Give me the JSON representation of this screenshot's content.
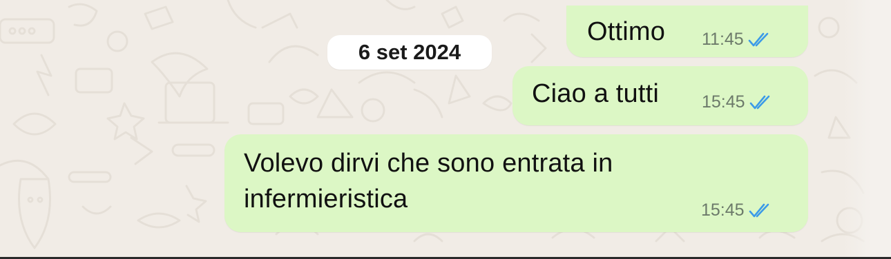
{
  "date_separator": "6 set 2024",
  "messages": [
    {
      "text": "Ottimo",
      "time": "11:45",
      "status": "read-double-check-icon"
    },
    {
      "text": "Ciao a tutti",
      "time": "15:45",
      "status": "read-double-check-icon"
    },
    {
      "text": "Volevo dirvi che sono entrata in\ninfermieristica",
      "time": "15:45",
      "status": "read-double-check-icon"
    }
  ],
  "colors": {
    "outgoing_bubble": "#dcf7c5",
    "chat_background": "#f1ece6",
    "read_ticks": "#3b9ae8",
    "timestamp": "#6c7a6a"
  }
}
